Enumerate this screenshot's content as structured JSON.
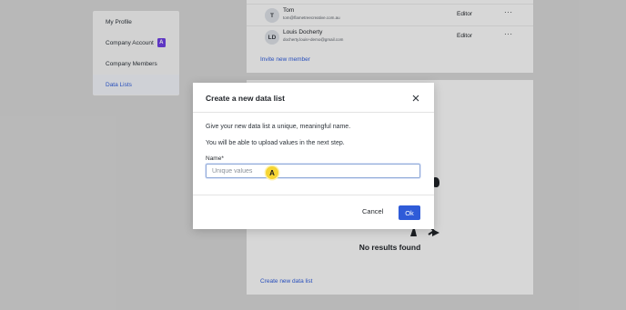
{
  "sidebar": {
    "items": [
      {
        "label": "My Profile"
      },
      {
        "label": "Company Account",
        "badge": "A"
      },
      {
        "label": "Company Members"
      },
      {
        "label": "Data Lists",
        "active": true
      }
    ]
  },
  "members": [
    {
      "initials": "T",
      "name": "Tom",
      "email": "tom@flametreecreative.com.au",
      "role": "Editor",
      "more": "···"
    },
    {
      "initials": "LD",
      "name": "Louis Docherty",
      "email": "docherty.louis+demo@gmail.com",
      "role": "Editor",
      "more": "···"
    }
  ],
  "invite_link": "Invite new member",
  "data_lists": {
    "empty_title": "No results found",
    "create_link": "Create new data list"
  },
  "modal": {
    "title": "Create a new data list",
    "line1": "Give your new data list a unique, meaningful name.",
    "line2": "You will be able to upload values in the next step.",
    "name_label": "Name",
    "required_mark": "*",
    "name_placeholder": "Unique values",
    "name_value": "",
    "cancel_label": "Cancel",
    "ok_label": "Ok"
  },
  "annotation_marker": "A",
  "colors": {
    "primary": "#2f5bd8",
    "badge": "#6d3ee0",
    "marker": "#f6d533"
  }
}
